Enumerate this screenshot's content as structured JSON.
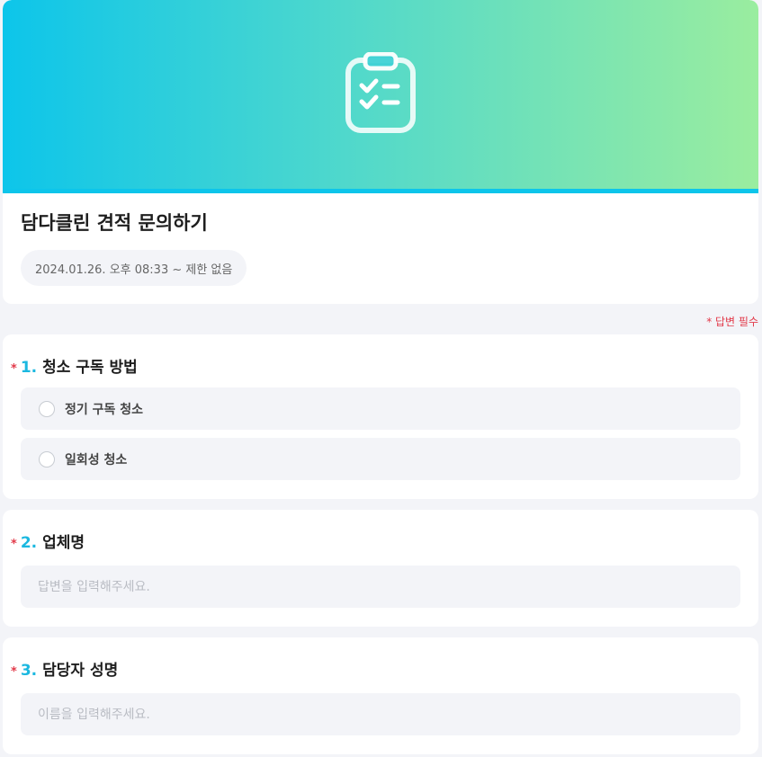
{
  "header": {
    "banner_icon": "clipboard-check-icon",
    "banner_colors": [
      "#0dc5ea",
      "#9aed9f"
    ],
    "title": "담다클린 견적 문의하기",
    "period": "2024.01.26. 오후 08:33 ~ 제한 없음"
  },
  "required_note": "* 답변 필수",
  "questions": [
    {
      "star": "*",
      "number": "1.",
      "title": "청소 구독 방법",
      "type": "radio",
      "options": [
        {
          "label": "정기 구독 청소",
          "selected": false
        },
        {
          "label": "일회성 청소",
          "selected": false
        }
      ]
    },
    {
      "star": "*",
      "number": "2.",
      "title": "업체명",
      "type": "text",
      "value": "",
      "placeholder": "답변을 입력해주세요."
    },
    {
      "star": "*",
      "number": "3.",
      "title": "담당자 성명",
      "type": "text",
      "value": "",
      "placeholder": "이름을 입력해주세요."
    }
  ],
  "colors": {
    "accent": "#1bb8e0",
    "required": "#e23a4a",
    "field_bg": "#f3f4f8"
  }
}
